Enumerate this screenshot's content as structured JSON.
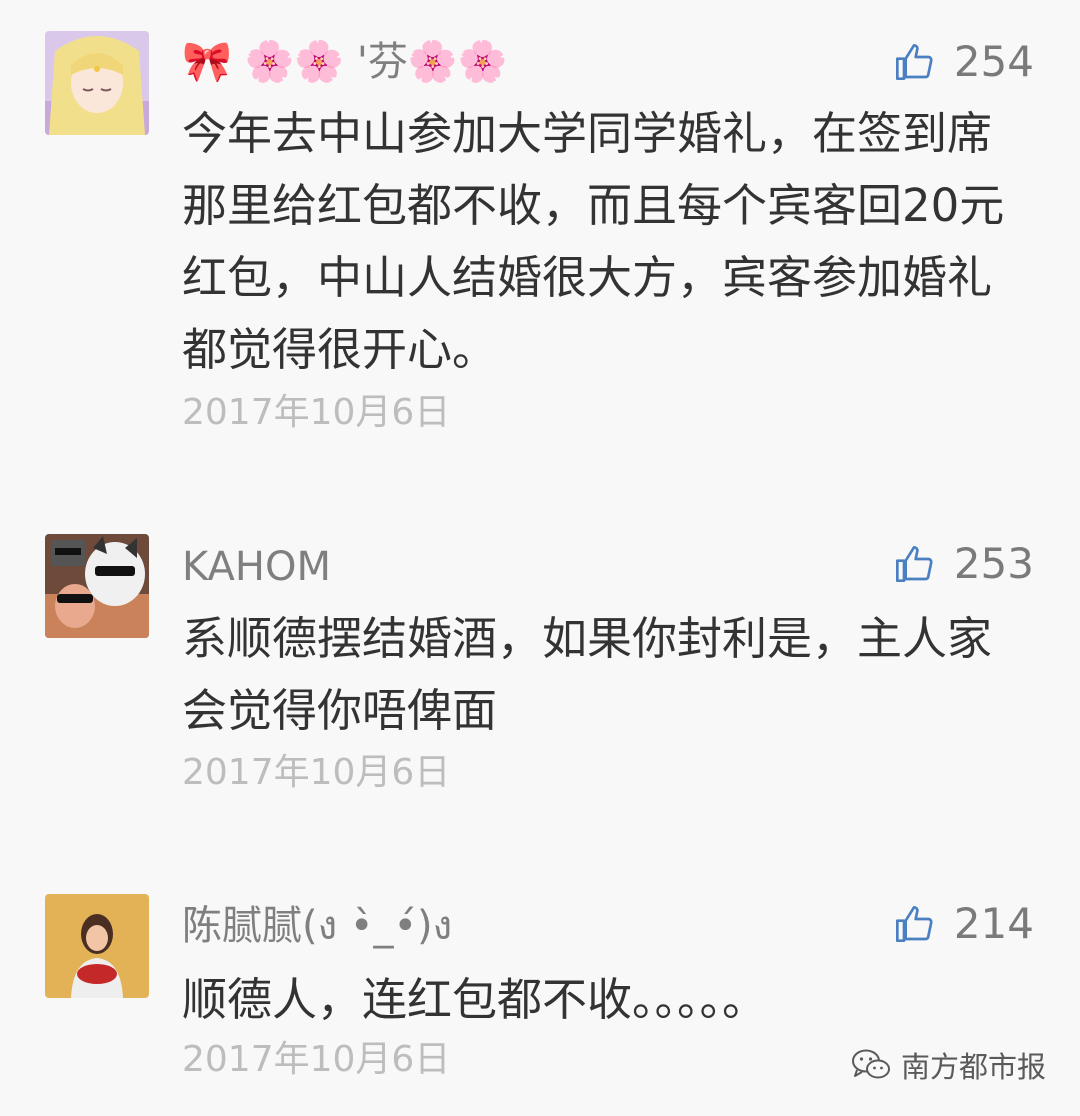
{
  "colors": {
    "like_icon": "#4a7fc2",
    "name_text": "#7f7f7f",
    "body_text": "#333333",
    "date_text": "#bdbdbd"
  },
  "comments": [
    {
      "author": "🎀 🌸🌸 '芬🌸🌸",
      "likes": "254",
      "text": "今年去中山参加大学同学婚礼，在签到席那里给红包都不收，而且每个宾客回20元红包，中山人结婚很大方，宾客参加婚礼都觉得很开心。",
      "date": "2017年10月6日",
      "avatar_icon": "anime-girl-avatar"
    },
    {
      "author": "KAHOM",
      "likes": "253",
      "text": "系顺德摆结婚酒，如果你封利是，主人家会觉得你唔俾面",
      "date": "2017年10月6日",
      "avatar_icon": "dog-sunglasses-avatar"
    },
    {
      "author": "陈腻腻(ง •̀_•́)ง",
      "likes": "214",
      "text": "顺德人，连红包都不收。。。。。",
      "date": "2017年10月6日",
      "avatar_icon": "person-photo-avatar"
    }
  ],
  "watermark": {
    "label": "南方都市报",
    "icon": "wechat-icon"
  }
}
